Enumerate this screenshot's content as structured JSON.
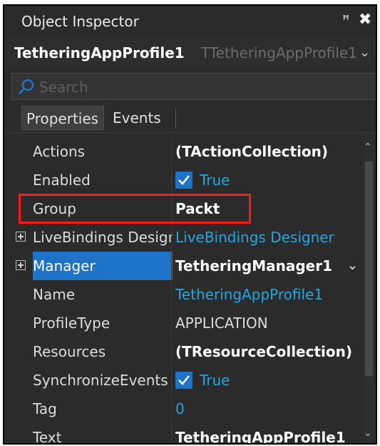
{
  "window": {
    "title": "Object Inspector",
    "pin_icon": "pin-icon",
    "close_icon": "close-icon"
  },
  "object_selector": {
    "name": "TetheringAppProfile1",
    "class_name": "TTetheringAppProfile1"
  },
  "search": {
    "placeholder": "Search",
    "value": ""
  },
  "tabs": [
    {
      "label": "Properties",
      "active": true
    },
    {
      "label": "Events",
      "active": false
    }
  ],
  "properties": [
    {
      "name": "Actions",
      "value": "(TActionCollection)"
    },
    {
      "name": "Enabled",
      "value": "True",
      "checked": true
    },
    {
      "name": "Group",
      "value": "Packt"
    },
    {
      "name": "LiveBindings Designer",
      "value": "LiveBindings Designer"
    },
    {
      "name": "Manager",
      "value": "TetheringManager1"
    },
    {
      "name": "Name",
      "value": "TetheringAppProfile1"
    },
    {
      "name": "ProfileType",
      "value": "APPLICATION"
    },
    {
      "name": "Resources",
      "value": "(TResourceCollection)"
    },
    {
      "name": "SynchronizeEvents",
      "value": "True",
      "checked": true
    },
    {
      "name": "Tag",
      "value": "0"
    },
    {
      "name": "Text",
      "value": "TetheringAppProfile1"
    }
  ],
  "colors": {
    "background": "#2b2b2b",
    "accent": "#1e72c8",
    "link": "#22a7e0",
    "highlight": "#ff1a1a"
  }
}
